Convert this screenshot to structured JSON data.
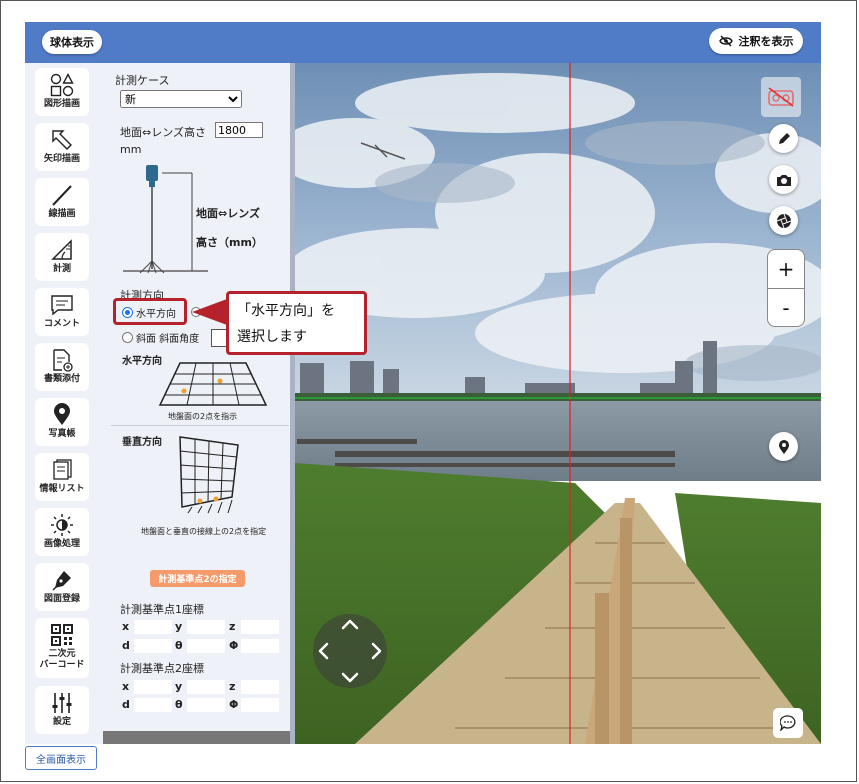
{
  "header": {
    "sphere_button": "球体表示",
    "annotation_button": "注釈を表示"
  },
  "tools": [
    {
      "label": "図形描画",
      "icon": "shapes-icon"
    },
    {
      "label": "矢印描画",
      "icon": "arrow-icon"
    },
    {
      "label": "線描画",
      "icon": "line-icon"
    },
    {
      "label": "計測",
      "icon": "measure-icon"
    },
    {
      "label": "コメント",
      "icon": "comment-icon"
    },
    {
      "label": "書類添付",
      "icon": "document-attach-icon"
    },
    {
      "label": "写真帳",
      "icon": "location-pin-icon"
    },
    {
      "label": "情報リスト",
      "icon": "info-list-icon"
    },
    {
      "label": "画像処理",
      "icon": "brightness-icon"
    },
    {
      "label": "図面登録",
      "icon": "pen-nib-icon"
    },
    {
      "label": "二次元\nバーコード",
      "label1": "二次元",
      "label2": "バーコード",
      "icon": "qr-code-icon"
    },
    {
      "label": "設定",
      "icon": "sliders-icon"
    }
  ],
  "panel": {
    "case_label": "計測ケース",
    "case_value": "新",
    "height_label": "地面⇔レンズ高さ",
    "height_value": "1800",
    "height_unit": "mm",
    "diagram_label1": "地面⇔レンズ",
    "diagram_label2": "高さ（mm）",
    "direction_label": "計測方向",
    "radio_horizontal": "水平方向",
    "radio_slope": "斜面 斜面角度",
    "horizontal_title": "水平方向",
    "horizontal_caption": "地盤面の2点を指示",
    "vertical_title": "垂直方向",
    "vertical_caption": "地盤面と垂直の接線上の2点を指定",
    "point2_button": "計測基準点2の指定",
    "point1_title": "計測基準点1座標",
    "point2_title": "計測基準点2座標",
    "coord_labels": {
      "x": "x",
      "y": "y",
      "z": "z",
      "d": "d",
      "theta": "θ",
      "phi": "Φ"
    }
  },
  "callout": {
    "line1": "「水平方向」を",
    "line2": "選択します"
  },
  "footer": {
    "fullscreen_button": "全画面表示"
  },
  "viewer": {
    "zoom_in": "+",
    "zoom_out": "-"
  },
  "colors": {
    "header_blue": "#4f7bc7",
    "callout_red": "#b5222c",
    "orange_button": "#f59a6a"
  }
}
